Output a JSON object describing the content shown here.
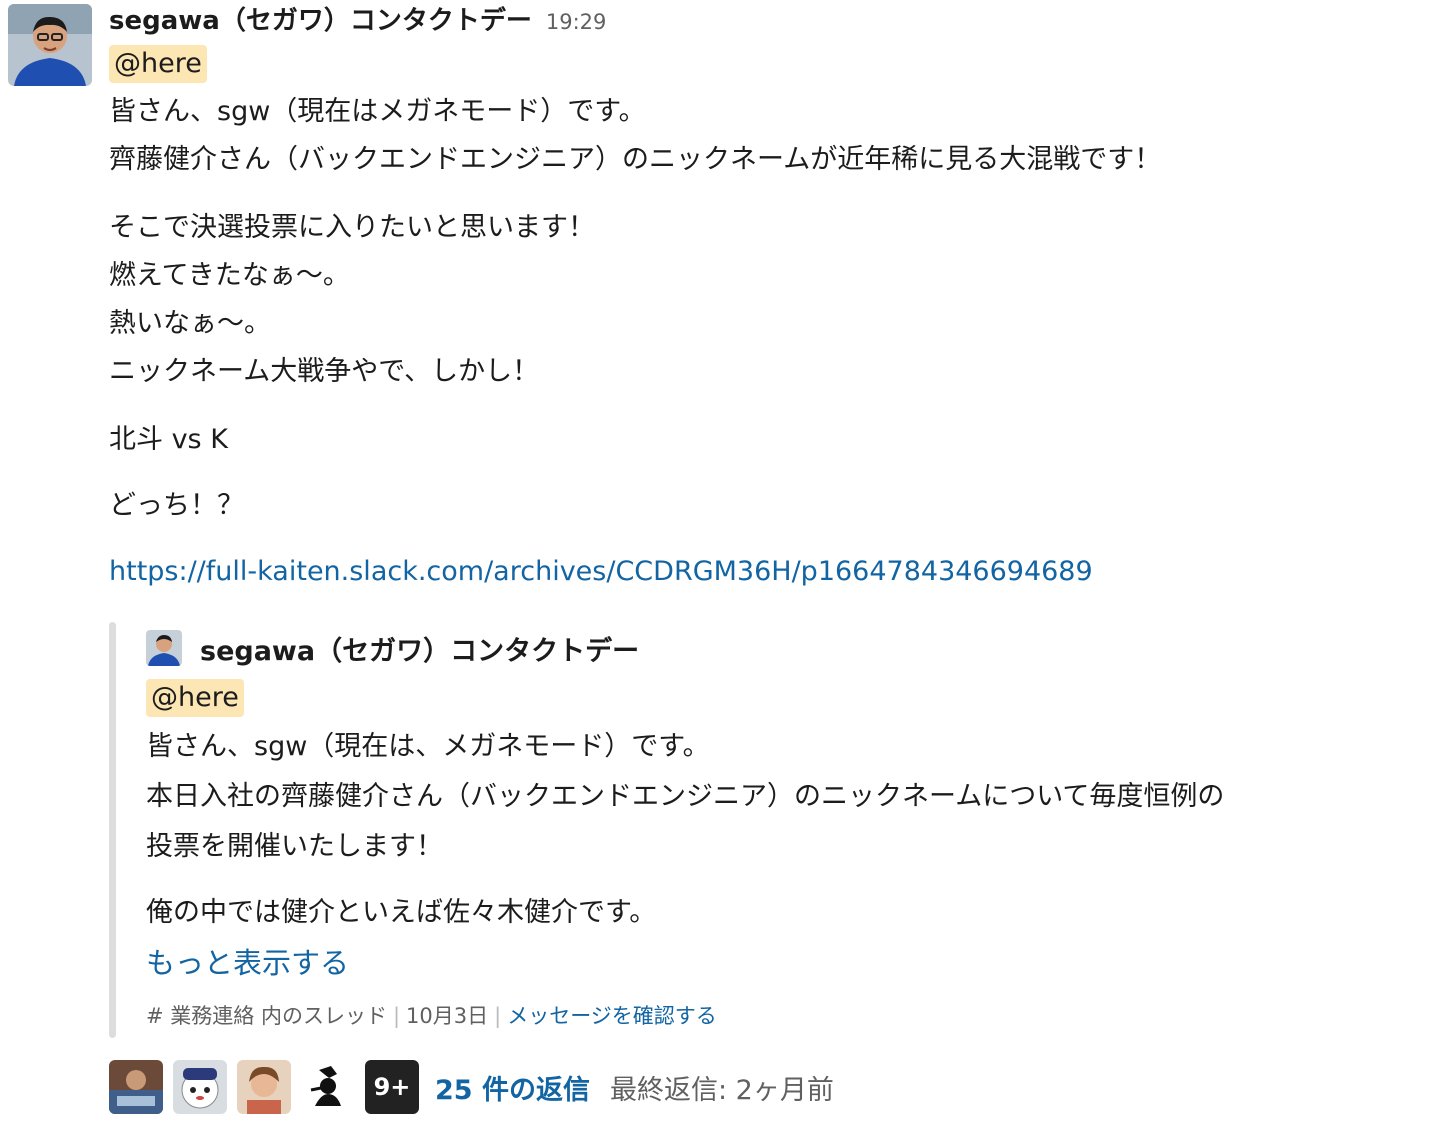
{
  "message": {
    "sender": "segawa（セガワ）コンタクトデー",
    "time": "19:29",
    "mention": "@here",
    "lines_a": [
      "皆さん、sgw（現在はメガネモード）です。",
      "齊藤健介さん（バックエンドエンジニア）のニックネームが近年稀に見る大混戦です！"
    ],
    "lines_b": [
      "そこで決選投票に入りたいと思います！",
      "燃えてきたなぁ〜。",
      "熱いなぁ〜。",
      "ニックネーム大戦争やで、しかし！"
    ],
    "line_c": "北斗 vs K",
    "line_d": "どっち！？",
    "link": "https://full-kaiten.slack.com/archives/CCDRGM36H/p1664784346694689"
  },
  "quoted": {
    "sender": "segawa（セガワ）コンタクトデー",
    "mention": "@here",
    "lines": [
      "皆さん、sgw（現在は、メガネモード）です。",
      "本日入社の齊藤健介さん（バックエンドエンジニア）のニックネームについて毎度恒例の",
      "投票を開催いたします！"
    ],
    "line2": "俺の中では健介といえば佐々木健介です。",
    "show_more": "もっと表示する",
    "footer": {
      "channel": "# 業務連絡 内のスレッド",
      "date": "10月3日",
      "view": "メッセージを確認する"
    }
  },
  "thread": {
    "extra_count": "9+",
    "reply_count": "25 件の返信",
    "last_reply": "最終返信: 2ヶ月前"
  },
  "colors": {
    "link": "#1264a3",
    "mention_bg": "#fbe6b4",
    "text": "#1d1c1d",
    "muted": "#616061"
  }
}
